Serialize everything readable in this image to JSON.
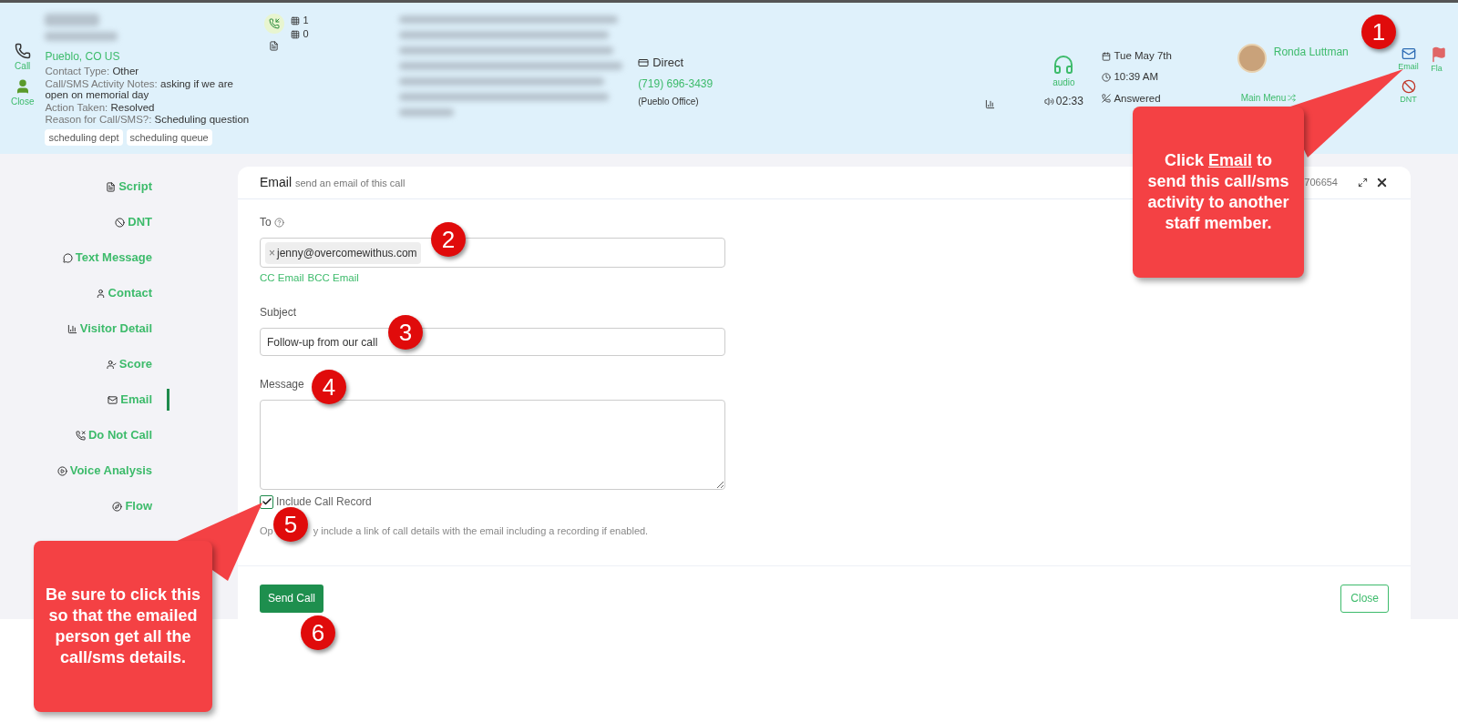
{
  "header": {
    "actions_left": [
      {
        "kind": "call",
        "label": "Call"
      },
      {
        "kind": "close",
        "label": "Close"
      }
    ],
    "location": "Pueblo, CO US",
    "details": [
      {
        "label": "Contact Type:",
        "value": "Other"
      },
      {
        "label": "Call/SMS Activity Notes:",
        "value": "asking if we are open on memorial day"
      },
      {
        "label": "Action Taken:",
        "value": "Resolved"
      },
      {
        "label": "Reason for Call/SMS?:",
        "value": "Scheduling question"
      }
    ],
    "tags": [
      "scheduling dept",
      "scheduling queue"
    ],
    "counts": [
      "1",
      "0"
    ],
    "source": {
      "title": "Direct",
      "number": "(719) 696-3439",
      "office": "(Pueblo Office)"
    },
    "audio": {
      "label": "audio",
      "duration": "02:33"
    },
    "when": {
      "date": "Tue May 7th",
      "time": "10:39 AM",
      "status": "Answered"
    },
    "agent": {
      "name": "Ronda Luttman",
      "menu": "Main Menu"
    },
    "actions_right": [
      {
        "kind": "email",
        "label": "Email"
      },
      {
        "kind": "dnt",
        "label": "DNT"
      },
      {
        "kind": "flag",
        "label": "Fla"
      }
    ]
  },
  "sidebar": {
    "items": [
      {
        "kind": "script",
        "label": "Script",
        "selected": false
      },
      {
        "kind": "dnt",
        "label": "DNT",
        "selected": false
      },
      {
        "kind": "text",
        "label": "Text Message",
        "selected": false
      },
      {
        "kind": "contact",
        "label": "Contact",
        "selected": false
      },
      {
        "kind": "visitor",
        "label": "Visitor Detail",
        "selected": false
      },
      {
        "kind": "score",
        "label": "Score",
        "selected": false
      },
      {
        "kind": "email",
        "label": "Email",
        "selected": true
      },
      {
        "kind": "donotcall",
        "label": "Do Not Call",
        "selected": false
      },
      {
        "kind": "voice",
        "label": "Voice Analysis",
        "selected": false
      },
      {
        "kind": "flow",
        "label": "Flow",
        "selected": false
      }
    ]
  },
  "panel": {
    "title": "Email",
    "subtitle": "send an email of this call",
    "id_fragment": "706654",
    "to": {
      "label": "To",
      "recipients": [
        {
          "remove": "×",
          "address": "jenny@overcomewithus.com"
        }
      ],
      "links": [
        "CC Email",
        "BCC Email"
      ]
    },
    "subject": {
      "label": "Subject",
      "value": "Follow-up from our call"
    },
    "message": {
      "label": "Message"
    },
    "include_record": {
      "label": "Include Call Record",
      "checked": true,
      "help_hidden_part": "Op",
      "help_rest": "y include a link of call details with the email including a recording if enabled."
    },
    "buttons": [
      {
        "kind": "primary",
        "label": "Send Call"
      },
      {
        "kind": "secondary",
        "label": "Close"
      }
    ]
  },
  "annotations": {
    "markers": [
      "1",
      "2",
      "3",
      "4",
      "5",
      "6"
    ],
    "callouts": [
      {
        "before": "Click ",
        "emphasis": "Email",
        "after": " to send this call/sms activity to another staff member."
      },
      {
        "before": "Be sure to click this so that the emailed person get all the call/sms details."
      }
    ]
  }
}
